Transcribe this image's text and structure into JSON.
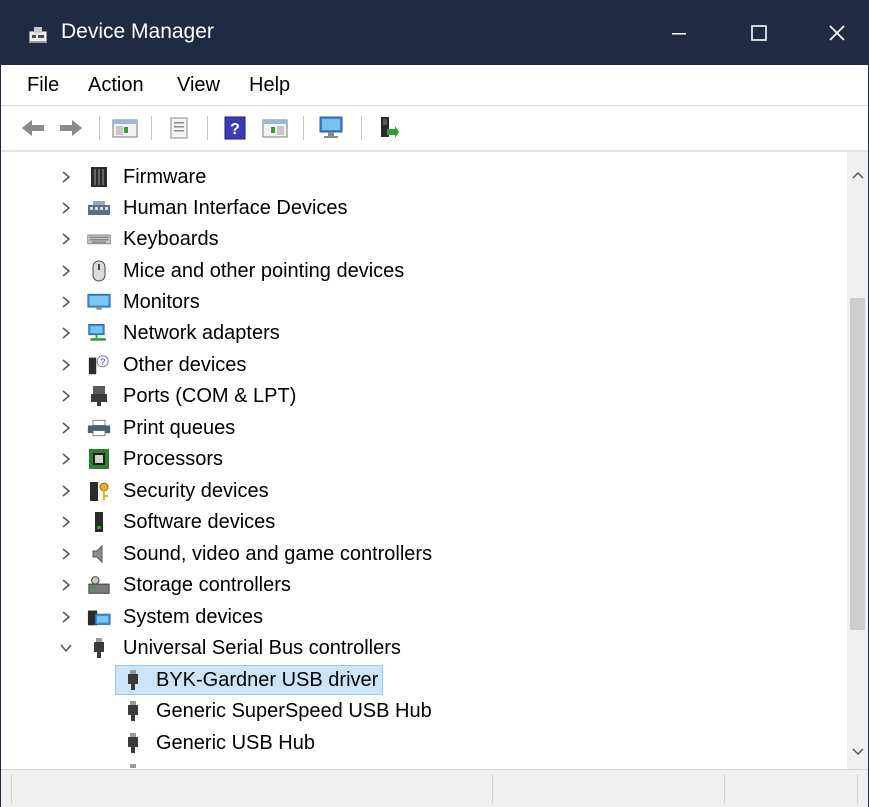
{
  "window": {
    "title": "Device Manager",
    "accent": "#1f2a44"
  },
  "menu": {
    "file": "File",
    "action": "Action",
    "view": "View",
    "help": "Help"
  },
  "toolbar": {
    "icons": [
      "back-arrow-icon",
      "forward-arrow-icon",
      "show-hide-console-tree-icon",
      "properties-icon",
      "help-icon",
      "action-pane-icon",
      "scan-hardware-icon",
      "update-driver-icon"
    ]
  },
  "tree": {
    "categories": [
      {
        "label": "Firmware",
        "icon": "firmware-icon",
        "expanded": false
      },
      {
        "label": "Human Interface Devices",
        "icon": "hid-icon",
        "expanded": false
      },
      {
        "label": "Keyboards",
        "icon": "keyboard-icon",
        "expanded": false
      },
      {
        "label": "Mice and other pointing devices",
        "icon": "mouse-icon",
        "expanded": false
      },
      {
        "label": "Monitors",
        "icon": "monitor-icon",
        "expanded": false
      },
      {
        "label": "Network adapters",
        "icon": "network-adapter-icon",
        "expanded": false
      },
      {
        "label": "Other devices",
        "icon": "unknown-device-icon",
        "expanded": false
      },
      {
        "label": "Ports (COM & LPT)",
        "icon": "port-icon",
        "expanded": false
      },
      {
        "label": "Print queues",
        "icon": "printer-icon",
        "expanded": false
      },
      {
        "label": "Processors",
        "icon": "processor-icon",
        "expanded": false
      },
      {
        "label": "Security devices",
        "icon": "security-device-icon",
        "expanded": false
      },
      {
        "label": "Software devices",
        "icon": "software-device-icon",
        "expanded": false
      },
      {
        "label": "Sound, video and game controllers",
        "icon": "speaker-icon",
        "expanded": false
      },
      {
        "label": "Storage controllers",
        "icon": "storage-controller-icon",
        "expanded": false
      },
      {
        "label": "System devices",
        "icon": "system-device-icon",
        "expanded": false
      },
      {
        "label": "Universal Serial Bus controllers",
        "icon": "usb-icon",
        "expanded": true
      }
    ],
    "usb_children": [
      {
        "label": "BYK-Gardner USB driver",
        "selected": true
      },
      {
        "label": "Generic SuperSpeed USB Hub",
        "selected": false
      },
      {
        "label": "Generic USB Hub",
        "selected": false
      }
    ],
    "selection_color": "#cce4f7"
  }
}
